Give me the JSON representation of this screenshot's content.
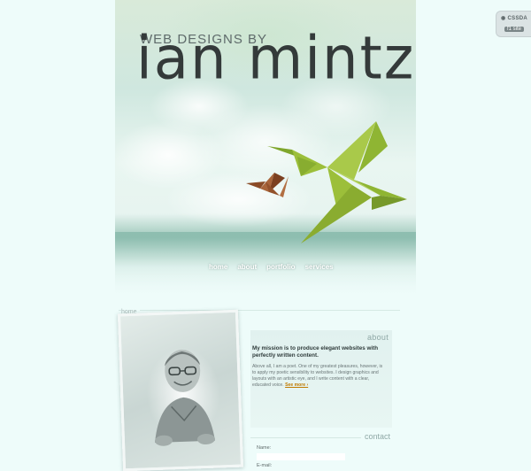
{
  "badge": {
    "logo": "CSSDA",
    "sub": "f1 site"
  },
  "header": {
    "tagline": "WEB DESIGNS BY",
    "title": "ian mintz"
  },
  "nav": {
    "items": [
      "home",
      "about",
      "portfolio",
      "services"
    ]
  },
  "breadcrumb": "home",
  "about": {
    "heading": "about",
    "mission": "My mission is to produce elegant websites with perfectly written content.",
    "body": "Above all, I am a poet. One of my greatest pleasures, however, is to apply my poetic sensibility to websites. I design graphics and layouts with an artistic eye, and I write content with a clear, educated voice.",
    "more_link": "See more ›"
  },
  "contact": {
    "heading": "contact",
    "name_label": "Name:",
    "email_label": "E-mail:"
  },
  "colors": {
    "background": "#eefcfa",
    "crane_green": "#9cbf3a",
    "crane_brown": "#9a5a32",
    "accent_link": "#c07a00"
  }
}
